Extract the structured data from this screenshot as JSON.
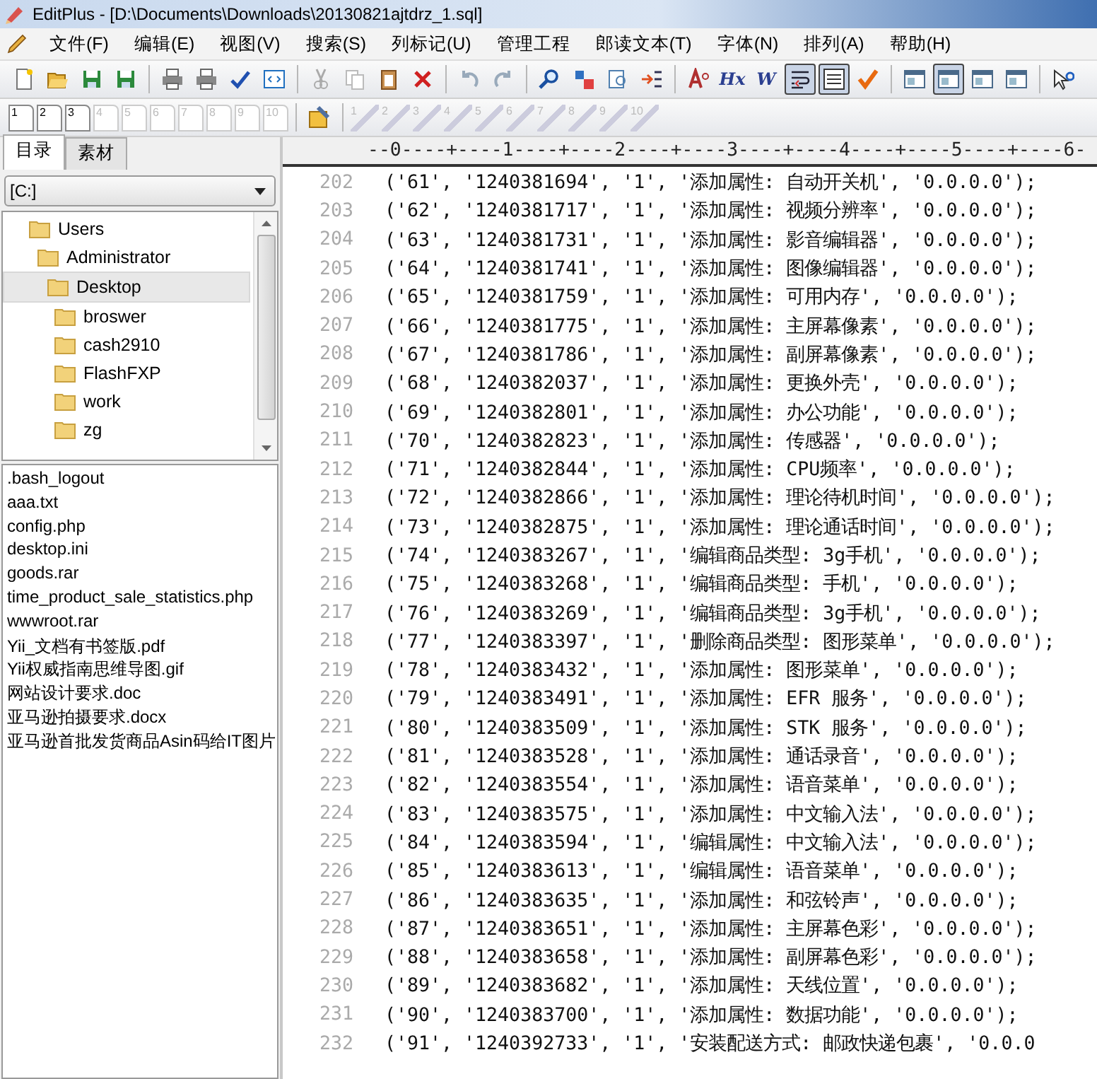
{
  "window": {
    "title": "EditPlus - [D:\\Documents\\Downloads\\20130821ajtdrz_1.sql]"
  },
  "menu": [
    "文件(F)",
    "编辑(E)",
    "视图(V)",
    "搜索(S)",
    "列标记(U)",
    "管理工程",
    "郎读文本(T)",
    "字体(N)",
    "排列(A)",
    "帮助(H)"
  ],
  "toolbar": [
    [
      {
        "kind": "new",
        "pressed": false
      },
      {
        "kind": "open",
        "pressed": false
      },
      {
        "kind": "save",
        "pressed": false
      },
      {
        "kind": "save-all",
        "pressed": false
      }
    ],
    [
      {
        "kind": "print-preview",
        "pressed": false
      },
      {
        "kind": "print",
        "pressed": false
      },
      {
        "kind": "spellcheck",
        "pressed": false
      },
      {
        "kind": "browser",
        "pressed": false
      }
    ],
    [
      {
        "kind": "cut",
        "pressed": false
      },
      {
        "kind": "copy",
        "pressed": false
      },
      {
        "kind": "paste",
        "pressed": false
      },
      {
        "kind": "delete",
        "pressed": false
      }
    ],
    [
      {
        "kind": "undo",
        "pressed": false
      },
      {
        "kind": "redo",
        "pressed": false
      }
    ],
    [
      {
        "kind": "find",
        "pressed": false
      },
      {
        "kind": "replace",
        "pressed": false
      },
      {
        "kind": "find-files",
        "pressed": false
      },
      {
        "kind": "goto",
        "pressed": false
      }
    ],
    [
      {
        "kind": "font",
        "pressed": false
      },
      {
        "kind": "glyph",
        "glyph": "Hx",
        "pressed": false
      },
      {
        "kind": "glyph",
        "glyph": "W",
        "pressed": false
      },
      {
        "kind": "wordwrap",
        "pressed": true
      },
      {
        "kind": "numbers",
        "pressed": true
      },
      {
        "kind": "check",
        "pressed": false
      }
    ],
    [
      {
        "kind": "panel",
        "pressed": false
      },
      {
        "kind": "panel",
        "pressed": true
      },
      {
        "kind": "panel",
        "pressed": false
      },
      {
        "kind": "panel",
        "pressed": false
      }
    ],
    [
      {
        "kind": "help",
        "pressed": false
      }
    ]
  ],
  "document_buttons": [
    {
      "label": "1",
      "disabled": false
    },
    {
      "label": "2",
      "disabled": false
    },
    {
      "label": "3",
      "disabled": false
    },
    {
      "label": "4",
      "disabled": true
    },
    {
      "label": "5",
      "disabled": true
    },
    {
      "label": "6",
      "disabled": true
    },
    {
      "label": "7",
      "disabled": true
    },
    {
      "label": "8",
      "disabled": true
    },
    {
      "label": "9",
      "disabled": true
    },
    {
      "label": "10",
      "disabled": true
    }
  ],
  "tool_buttons": [
    {
      "label": "1",
      "disabled": true
    },
    {
      "label": "2",
      "disabled": true
    },
    {
      "label": "3",
      "disabled": true
    },
    {
      "label": "4",
      "disabled": true
    },
    {
      "label": "5",
      "disabled": true
    },
    {
      "label": "6",
      "disabled": true
    },
    {
      "label": "7",
      "disabled": true
    },
    {
      "label": "8",
      "disabled": true
    },
    {
      "label": "9",
      "disabled": true
    },
    {
      "label": "10",
      "disabled": true
    }
  ],
  "sidebar": {
    "tabs": [
      {
        "label": "目录",
        "selected": true
      },
      {
        "label": "素材",
        "selected": false
      }
    ],
    "drive": "[C:]",
    "tree": [
      {
        "label": "Users",
        "selected": false,
        "children": [
          {
            "label": "Administrator",
            "selected": false,
            "children": [
              {
                "label": "Desktop",
                "selected": true,
                "children": [
                  {
                    "label": "broswer",
                    "selected": false
                  },
                  {
                    "label": "cash2910",
                    "selected": false
                  },
                  {
                    "label": "FlashFXP",
                    "selected": false
                  },
                  {
                    "label": "work",
                    "selected": false
                  },
                  {
                    "label": "zg",
                    "selected": false
                  }
                ]
              }
            ]
          }
        ]
      }
    ],
    "files": [
      ".bash_logout",
      "aaa.txt",
      "config.php",
      "desktop.ini",
      "goods.rar",
      "time_product_sale_statistics.php",
      "wwwroot.rar",
      "Yii_文档有书签版.pdf",
      "Yii权威指南思维导图.gif",
      "网站设计要求.doc",
      "亚马逊拍摄要求.docx",
      "亚马逊首批发货商品Asin码给IT图片"
    ]
  },
  "editor": {
    "ruler": "--0----+----1----+----2----+----3----+----4----+----5----+----6-",
    "lines": [
      {
        "number": "202",
        "code": "('61', '1240381694', '1', '添加属性: 自动开关机', '0.0.0.0');"
      },
      {
        "number": "203",
        "code": "('62', '1240381717', '1', '添加属性: 视频分辨率', '0.0.0.0');"
      },
      {
        "number": "204",
        "code": "('63', '1240381731', '1', '添加属性: 影音编辑器', '0.0.0.0');"
      },
      {
        "number": "205",
        "code": "('64', '1240381741', '1', '添加属性: 图像编辑器', '0.0.0.0');"
      },
      {
        "number": "206",
        "code": "('65', '1240381759', '1', '添加属性: 可用内存', '0.0.0.0');"
      },
      {
        "number": "207",
        "code": "('66', '1240381775', '1', '添加属性: 主屏幕像素', '0.0.0.0');"
      },
      {
        "number": "208",
        "code": "('67', '1240381786', '1', '添加属性: 副屏幕像素', '0.0.0.0');"
      },
      {
        "number": "209",
        "code": "('68', '1240382037', '1', '添加属性: 更换外壳', '0.0.0.0');"
      },
      {
        "number": "210",
        "code": "('69', '1240382801', '1', '添加属性: 办公功能', '0.0.0.0');"
      },
      {
        "number": "211",
        "code": "('70', '1240382823', '1', '添加属性: 传感器', '0.0.0.0');"
      },
      {
        "number": "212",
        "code": "('71', '1240382844', '1', '添加属性: CPU频率', '0.0.0.0');"
      },
      {
        "number": "213",
        "code": "('72', '1240382866', '1', '添加属性: 理论待机时间', '0.0.0.0');"
      },
      {
        "number": "214",
        "code": "('73', '1240382875', '1', '添加属性: 理论通话时间', '0.0.0.0');"
      },
      {
        "number": "215",
        "code": "('74', '1240383267', '1', '编辑商品类型: 3g手机', '0.0.0.0');"
      },
      {
        "number": "216",
        "code": "('75', '1240383268', '1', '编辑商品类型: 手机', '0.0.0.0');"
      },
      {
        "number": "217",
        "code": "('76', '1240383269', '1', '编辑商品类型: 3g手机', '0.0.0.0');"
      },
      {
        "number": "218",
        "code": "('77', '1240383397', '1', '删除商品类型: 图形菜单', '0.0.0.0');"
      },
      {
        "number": "219",
        "code": "('78', '1240383432', '1', '添加属性: 图形菜单', '0.0.0.0');"
      },
      {
        "number": "220",
        "code": "('79', '1240383491', '1', '添加属性: EFR 服务', '0.0.0.0');"
      },
      {
        "number": "221",
        "code": "('80', '1240383509', '1', '添加属性: STK 服务', '0.0.0.0');"
      },
      {
        "number": "222",
        "code": "('81', '1240383528', '1', '添加属性: 通话录音', '0.0.0.0');"
      },
      {
        "number": "223",
        "code": "('82', '1240383554', '1', '添加属性: 语音菜单', '0.0.0.0');"
      },
      {
        "number": "224",
        "code": "('83', '1240383575', '1', '添加属性: 中文输入法', '0.0.0.0');"
      },
      {
        "number": "225",
        "code": "('84', '1240383594', '1', '编辑属性: 中文输入法', '0.0.0.0');"
      },
      {
        "number": "226",
        "code": "('85', '1240383613', '1', '编辑属性: 语音菜单', '0.0.0.0');"
      },
      {
        "number": "227",
        "code": "('86', '1240383635', '1', '添加属性: 和弦铃声', '0.0.0.0');"
      },
      {
        "number": "228",
        "code": "('87', '1240383651', '1', '添加属性: 主屏幕色彩', '0.0.0.0');"
      },
      {
        "number": "229",
        "code": "('88', '1240383658', '1', '添加属性: 副屏幕色彩', '0.0.0.0');"
      },
      {
        "number": "230",
        "code": "('89', '1240383682', '1', '添加属性: 天线位置', '0.0.0.0');"
      },
      {
        "number": "231",
        "code": "('90', '1240383700', '1', '添加属性: 数据功能', '0.0.0.0');"
      },
      {
        "number": "232",
        "code": "('91', '1240392733', '1', '安装配送方式: 邮政快递包裹', '0.0.0"
      }
    ]
  }
}
